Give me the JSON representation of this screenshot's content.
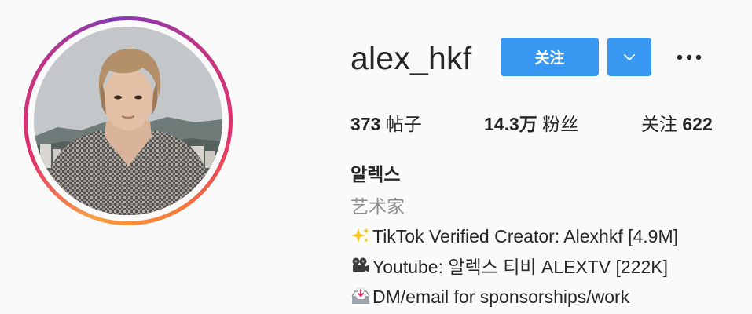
{
  "profile": {
    "username": "alex_hkf",
    "follow_label": "关注",
    "dropdown_icon": "chevron-down-icon",
    "more_icon": "more-options-icon"
  },
  "stats": {
    "posts_count": "373",
    "posts_label": "帖子",
    "followers_count": "14.3万",
    "followers_label": "粉丝",
    "following_label": "关注",
    "following_count": "622"
  },
  "bio": {
    "full_name": "알렉스",
    "category": "艺术家",
    "line1_icon": "sparkles-icon",
    "line1": "TikTok Verified Creator: Alexhkf [4.9M]",
    "line2_icon": "movie-camera-icon",
    "line2": "Youtube: 알렉스 티비 ALEXTV [222K]",
    "line3_icon": "inbox-tray-icon",
    "line3": "DM/email for sponsorships/work"
  },
  "colors": {
    "primary_button": "#3897f0",
    "text": "#262626",
    "secondary_text": "#8e8e8e",
    "background": "#fafafa"
  }
}
